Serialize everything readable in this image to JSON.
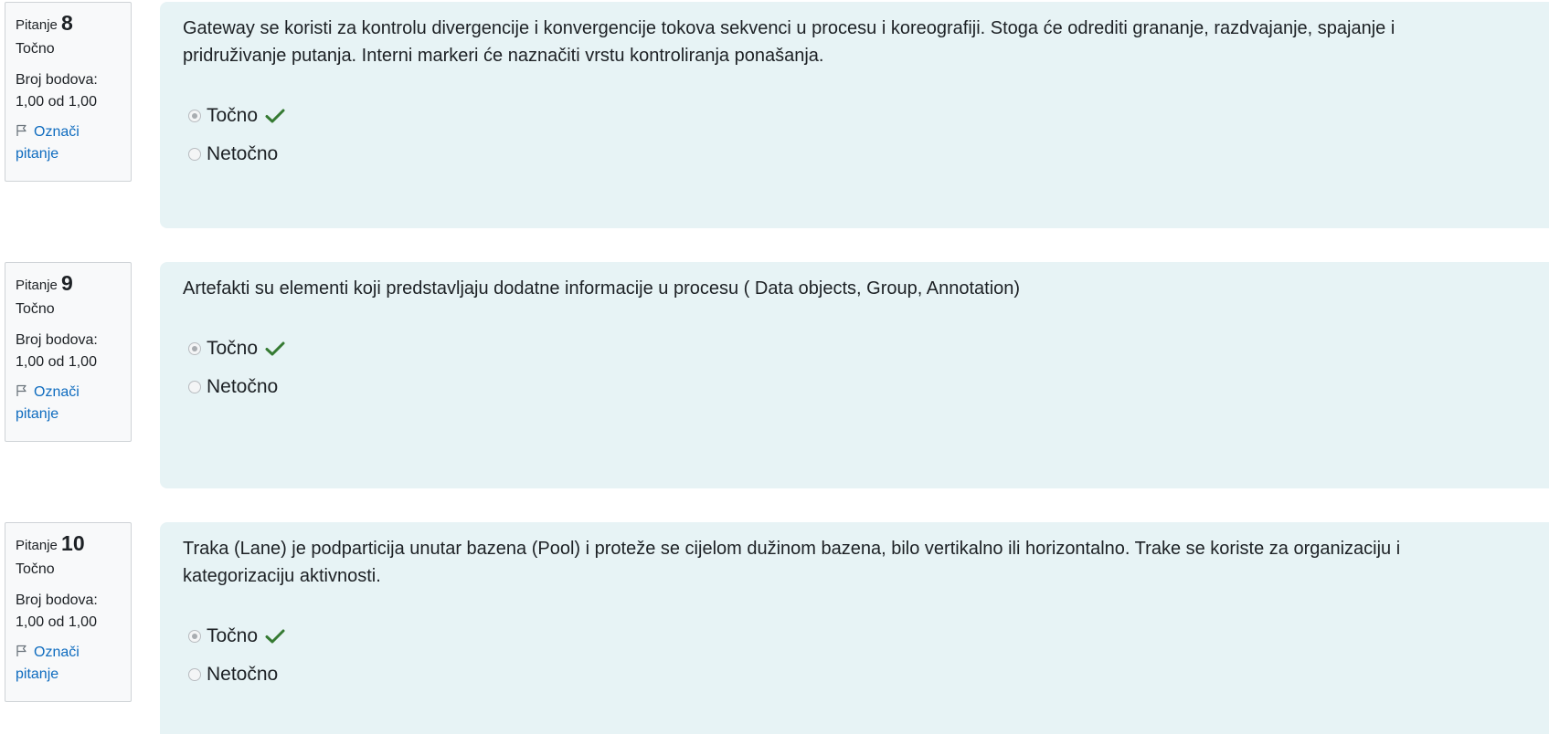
{
  "questions": [
    {
      "label": "Pitanje",
      "number": "8",
      "state": "Točno",
      "grade": "Broj bodova: 1,00 od 1,00",
      "flag_label": "Označi pitanje",
      "text": "Gateway se koristi za kontrolu divergencije i konvergencije tokova sekvenci u procesu i koreografiji. Stoga će odrediti grananje, razdvajanje, spajanje i pridruživanje putanja. Interni markeri će naznačiti vrstu kontroliranja ponašanja.",
      "options": [
        {
          "label": "Točno",
          "selected": true,
          "correct": true
        },
        {
          "label": "Netočno",
          "selected": false,
          "correct": false
        }
      ]
    },
    {
      "label": "Pitanje",
      "number": "9",
      "state": "Točno",
      "grade": "Broj bodova: 1,00 od 1,00",
      "flag_label": "Označi pitanje",
      "text": "Artefakti su elementi koji predstavljaju dodatne informacije u procesu ( Data objects, Group, Annotation)",
      "options": [
        {
          "label": "Točno",
          "selected": true,
          "correct": true
        },
        {
          "label": "Netočno",
          "selected": false,
          "correct": false
        }
      ]
    },
    {
      "label": "Pitanje",
      "number": "10",
      "state": "Točno",
      "grade": "Broj bodova: 1,00 od 1,00",
      "flag_label": "Označi pitanje",
      "text": "Traka (Lane) je podparticija unutar bazena (Pool) i proteže se cijelom dužinom bazena, bilo vertikalno ili horizontalno. Trake se koriste za organizaciju i kategorizaciju aktivnosti.",
      "options": [
        {
          "label": "Točno",
          "selected": true,
          "correct": true
        },
        {
          "label": "Netočno",
          "selected": false,
          "correct": false
        }
      ]
    }
  ],
  "icons": {
    "flag": "flag-icon",
    "correct": "check-icon"
  },
  "colors": {
    "panel_background": "#e7f3f5",
    "info_background": "#f8f9fa",
    "link": "#0f6cbf",
    "correct_check": "#357a32"
  }
}
